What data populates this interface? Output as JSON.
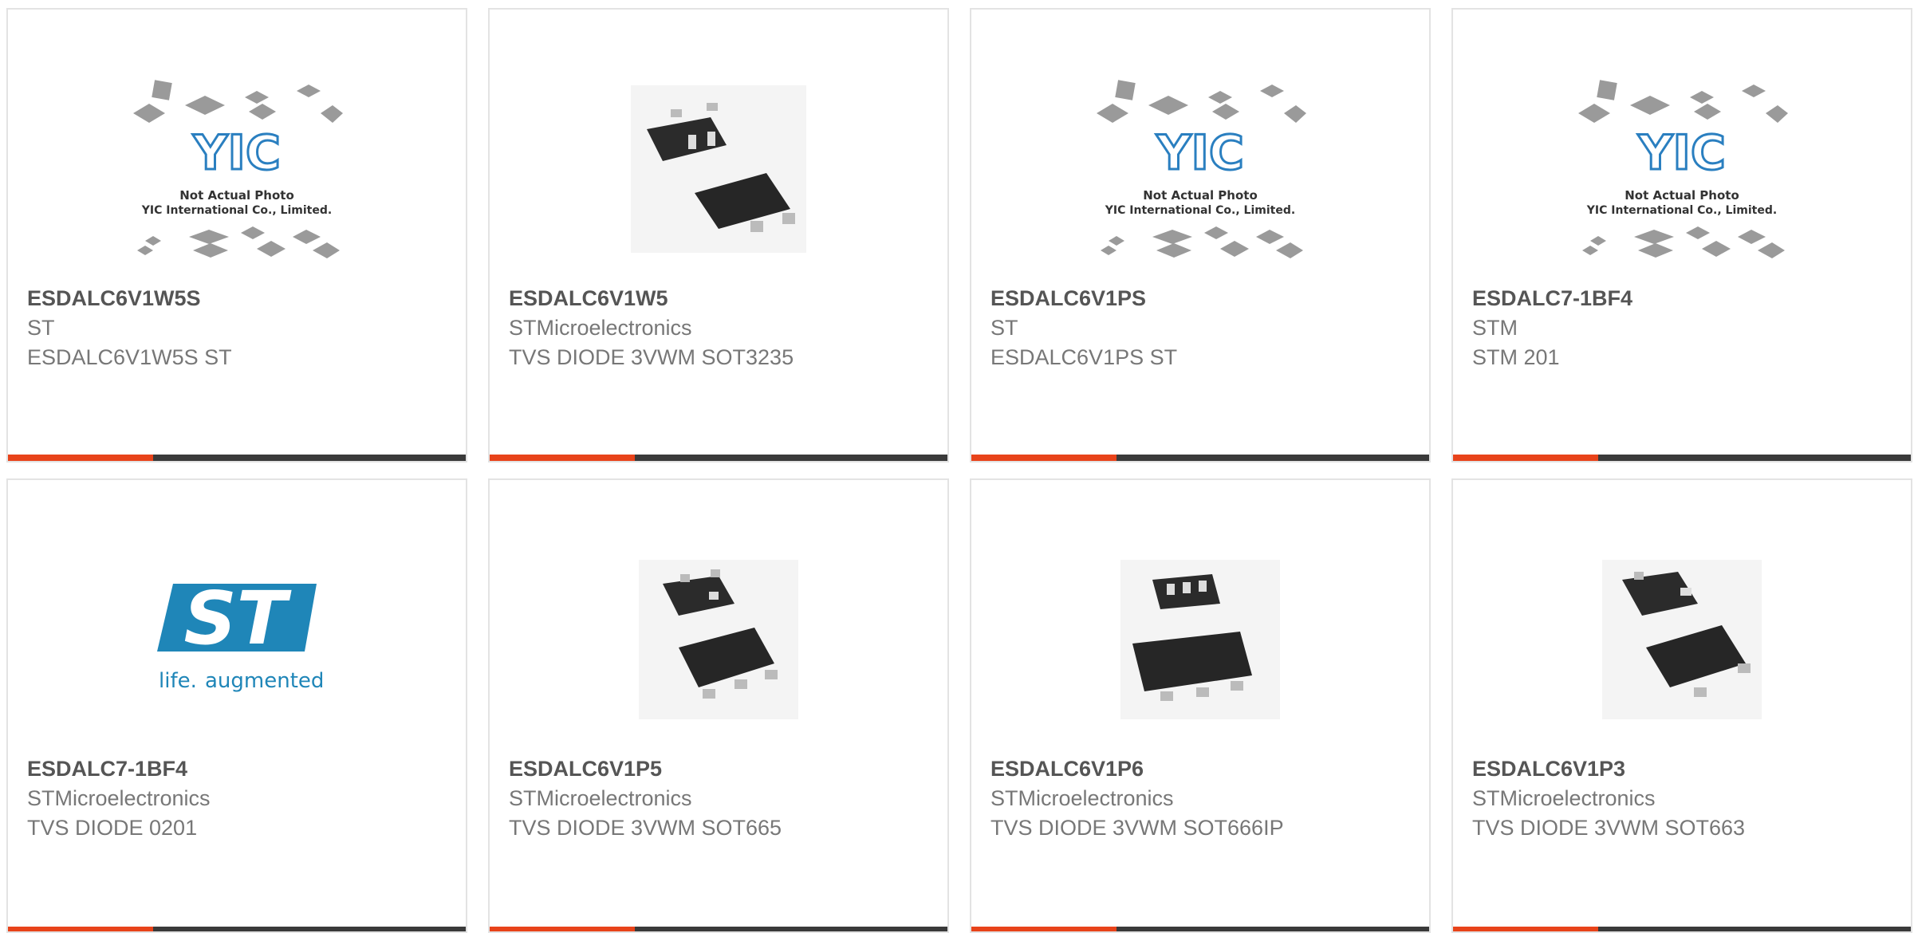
{
  "placeholder": {
    "logo_text": "YIC",
    "line1": "Not Actual Photo",
    "line2": "YIC International Co., Limited."
  },
  "st_logo": {
    "brand": "ST",
    "tagline_a": "life.",
    "tagline_b": "augmented"
  },
  "colors": {
    "accent": "#e8431a",
    "bar": "#3a3a3a",
    "title": "#555555",
    "text": "#777777"
  },
  "products": [
    {
      "part": "ESDALC6V1W5S",
      "manufacturer": "ST",
      "description": "ESDALC6V1W5S ST",
      "image": "yic-placeholder"
    },
    {
      "part": "ESDALC6V1W5",
      "manufacturer": "STMicroelectronics",
      "description": "TVS DIODE 3VWM SOT3235",
      "image": "sot323-5-package"
    },
    {
      "part": "ESDALC6V1PS",
      "manufacturer": "ST",
      "description": "ESDALC6V1PS ST",
      "image": "yic-placeholder"
    },
    {
      "part": "ESDALC7-1BF4",
      "manufacturer": "STM",
      "description": "STM 201",
      "image": "yic-placeholder"
    },
    {
      "part": "ESDALC7-1BF4",
      "manufacturer": "STMicroelectronics",
      "description": "TVS DIODE 0201",
      "image": "st-logo"
    },
    {
      "part": "ESDALC6V1P5",
      "manufacturer": "STMicroelectronics",
      "description": "TVS DIODE 3VWM SOT665",
      "image": "sot665-package"
    },
    {
      "part": "ESDALC6V1P6",
      "manufacturer": "STMicroelectronics",
      "description": "TVS DIODE 3VWM SOT666IP",
      "image": "sot666-package"
    },
    {
      "part": "ESDALC6V1P3",
      "manufacturer": "STMicroelectronics",
      "description": "TVS DIODE 3VWM SOT663",
      "image": "sot663-package"
    }
  ]
}
